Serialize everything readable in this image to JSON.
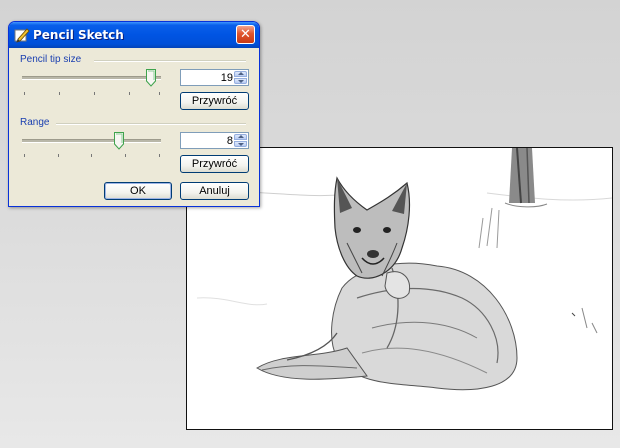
{
  "dialog": {
    "title": "Pencil Sketch",
    "close_glyph": "✕",
    "pencil_tip": {
      "label": "Pencil tip size",
      "value": "19",
      "slider_level": 0.93,
      "reset_label": "Przywróć"
    },
    "range": {
      "label": "Range",
      "value": "8",
      "slider_level": 0.7,
      "reset_label": "Przywróć"
    },
    "ok_label": "OK",
    "cancel_label": "Anuluj"
  },
  "icons": {
    "title_icon": "pencil-sketch-icon",
    "close_icon": "close-icon",
    "spin_up": "arrow-up-icon",
    "spin_down": "arrow-down-icon"
  },
  "colors": {
    "titlebar": "#0054e3",
    "group_label": "#1a3fb0",
    "slider_thumb": "#3fa34d"
  }
}
